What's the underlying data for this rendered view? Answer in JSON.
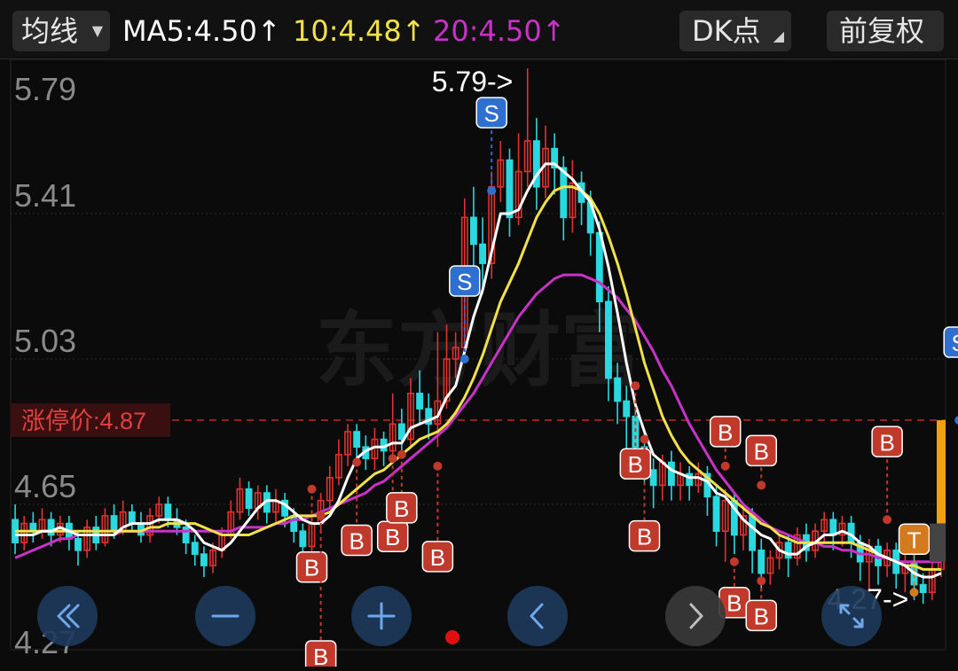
{
  "toolbar": {
    "ma_button_label": "均线",
    "ma5_text": "MA5:4.50↑",
    "ma10_text": "10:4.48↑",
    "ma20_text": "20:4.50↑",
    "dk_button_label": "DK点",
    "fuquan_button_label": "前复权"
  },
  "colors": {
    "up": "#e0322e",
    "down": "#2ad8e0",
    "ma5": "#ffffff",
    "ma10": "#f2e14a",
    "ma20": "#c832c8",
    "limit_line": "#c0282a",
    "signal_b": "#c0392b",
    "signal_s": "#2f6fd0",
    "signal_t": "#d47a1e",
    "nav_button": "#1e3a5c"
  },
  "watermark": "东方财富",
  "chart_data": {
    "type": "candlestick",
    "y_axis_ticks": [
      "5.79",
      "5.41",
      "5.03",
      "4.65",
      "4.27"
    ],
    "ylim": [
      4.27,
      5.79
    ],
    "limit_price_label": "涨停价:4.87",
    "limit_price_value": 4.87,
    "max_annotation": "5.79->",
    "min_annotation": "4.27->",
    "candles": [
      [
        4.61,
        4.55,
        4.65,
        4.52
      ],
      [
        4.55,
        4.6,
        4.62,
        4.53
      ],
      [
        4.6,
        4.58,
        4.63,
        4.55
      ],
      [
        4.58,
        4.61,
        4.64,
        4.56
      ],
      [
        4.61,
        4.57,
        4.63,
        4.54
      ],
      [
        4.57,
        4.6,
        4.62,
        4.55
      ],
      [
        4.6,
        4.56,
        4.62,
        4.53
      ],
      [
        4.56,
        4.53,
        4.58,
        4.49
      ],
      [
        4.53,
        4.59,
        4.61,
        4.51
      ],
      [
        4.59,
        4.55,
        4.62,
        4.53
      ],
      [
        4.55,
        4.62,
        4.64,
        4.54
      ],
      [
        4.62,
        4.58,
        4.65,
        4.56
      ],
      [
        4.58,
        4.63,
        4.66,
        4.57
      ],
      [
        4.63,
        4.6,
        4.65,
        4.58
      ],
      [
        4.6,
        4.57,
        4.63,
        4.55
      ],
      [
        4.57,
        4.62,
        4.64,
        4.55
      ],
      [
        4.62,
        4.65,
        4.67,
        4.6
      ],
      [
        4.65,
        4.61,
        4.67,
        4.59
      ],
      [
        4.61,
        4.59,
        4.64,
        4.57
      ],
      [
        4.59,
        4.55,
        4.61,
        4.52
      ],
      [
        4.55,
        4.52,
        4.57,
        4.49
      ],
      [
        4.52,
        4.49,
        4.54,
        4.46
      ],
      [
        4.49,
        4.53,
        4.55,
        4.47
      ],
      [
        4.53,
        4.57,
        4.59,
        4.51
      ],
      [
        4.57,
        4.63,
        4.66,
        4.56
      ],
      [
        4.63,
        4.69,
        4.72,
        4.61
      ],
      [
        4.69,
        4.64,
        4.71,
        4.62
      ],
      [
        4.64,
        4.68,
        4.7,
        4.61
      ],
      [
        4.68,
        4.63,
        4.7,
        4.6
      ],
      [
        4.63,
        4.66,
        4.69,
        4.6
      ],
      [
        4.66,
        4.62,
        4.68,
        4.59
      ],
      [
        4.62,
        4.58,
        4.64,
        4.55
      ],
      [
        4.58,
        4.54,
        4.6,
        4.5
      ],
      [
        4.54,
        4.6,
        4.62,
        4.52
      ],
      [
        4.6,
        4.66,
        4.68,
        4.58
      ],
      [
        4.66,
        4.72,
        4.75,
        4.64
      ],
      [
        4.72,
        4.78,
        4.82,
        4.7
      ],
      [
        4.78,
        4.84,
        4.86,
        4.75
      ],
      [
        4.84,
        4.8,
        4.86,
        4.77
      ],
      [
        4.8,
        4.77,
        4.83,
        4.74
      ],
      [
        4.77,
        4.82,
        4.85,
        4.74
      ],
      [
        4.82,
        4.79,
        4.84,
        4.75
      ],
      [
        4.79,
        4.86,
        4.94,
        4.76
      ],
      [
        4.86,
        4.82,
        4.9,
        4.78
      ],
      [
        4.82,
        4.94,
        4.98,
        4.8
      ],
      [
        4.94,
        4.9,
        5.0,
        4.86
      ],
      [
        4.9,
        4.86,
        4.94,
        4.82
      ],
      [
        4.86,
        4.92,
        5.1,
        4.8
      ],
      [
        4.92,
        5.03,
        5.12,
        4.9
      ],
      [
        5.03,
        5.06,
        5.1,
        4.98
      ],
      [
        5.06,
        5.4,
        5.45,
        5.04
      ],
      [
        5.4,
        5.33,
        5.48,
        5.25
      ],
      [
        5.33,
        5.28,
        5.4,
        5.2
      ],
      [
        5.28,
        5.48,
        5.52,
        5.24
      ],
      [
        5.48,
        5.55,
        5.6,
        5.44
      ],
      [
        5.55,
        5.4,
        5.58,
        5.35
      ],
      [
        5.4,
        5.52,
        5.62,
        5.38
      ],
      [
        5.52,
        5.6,
        5.79,
        5.48
      ],
      [
        5.6,
        5.48,
        5.66,
        5.42
      ],
      [
        5.48,
        5.58,
        5.64,
        5.45
      ],
      [
        5.58,
        5.53,
        5.62,
        5.46
      ],
      [
        5.53,
        5.4,
        5.56,
        5.34
      ],
      [
        5.4,
        5.49,
        5.55,
        5.36
      ],
      [
        5.49,
        5.44,
        5.52,
        5.38
      ],
      [
        5.44,
        5.36,
        5.47,
        5.3
      ],
      [
        5.36,
        5.18,
        5.39,
        5.1
      ],
      [
        5.18,
        4.98,
        5.22,
        4.92
      ],
      [
        4.98,
        4.92,
        5.02,
        4.86
      ],
      [
        4.92,
        4.88,
        4.96,
        4.76
      ],
      [
        4.88,
        4.8,
        4.92,
        4.72
      ],
      [
        4.8,
        4.74,
        4.84,
        4.7
      ],
      [
        4.74,
        4.7,
        4.77,
        4.64
      ],
      [
        4.7,
        4.76,
        4.78,
        4.66
      ],
      [
        4.76,
        4.7,
        4.79,
        4.66
      ],
      [
        4.7,
        4.73,
        4.76,
        4.66
      ],
      [
        4.73,
        4.7,
        4.75,
        4.66
      ],
      [
        4.7,
        4.73,
        4.76,
        4.68
      ],
      [
        4.73,
        4.67,
        4.75,
        4.62
      ],
      [
        4.67,
        4.58,
        4.7,
        4.54
      ],
      [
        4.58,
        4.66,
        4.69,
        4.5
      ],
      [
        4.66,
        4.57,
        4.68,
        4.52
      ],
      [
        4.57,
        4.62,
        4.65,
        4.53
      ],
      [
        4.62,
        4.53,
        4.64,
        4.47
      ],
      [
        4.53,
        4.47,
        4.56,
        4.43
      ],
      [
        4.47,
        4.51,
        4.53,
        4.44
      ],
      [
        4.51,
        4.55,
        4.57,
        4.48
      ],
      [
        4.55,
        4.51,
        4.57,
        4.46
      ],
      [
        4.51,
        4.57,
        4.59,
        4.49
      ],
      [
        4.57,
        4.53,
        4.6,
        4.5
      ],
      [
        4.53,
        4.58,
        4.6,
        4.51
      ],
      [
        4.58,
        4.61,
        4.63,
        4.55
      ],
      [
        4.61,
        4.57,
        4.63,
        4.53
      ],
      [
        4.57,
        4.6,
        4.62,
        4.54
      ],
      [
        4.6,
        4.55,
        4.62,
        4.51
      ],
      [
        4.55,
        4.5,
        4.57,
        4.45
      ],
      [
        4.5,
        4.54,
        4.56,
        4.42
      ],
      [
        4.54,
        4.49,
        4.56,
        4.44
      ],
      [
        4.49,
        4.53,
        4.55,
        4.46
      ],
      [
        4.53,
        4.47,
        4.55,
        4.43
      ],
      [
        4.47,
        4.5,
        4.52,
        4.42
      ],
      [
        4.5,
        4.44,
        4.52,
        4.4
      ],
      [
        4.44,
        4.42,
        4.47,
        4.39
      ],
      [
        4.42,
        4.48,
        4.5,
        4.4
      ],
      [
        4.48,
        4.52,
        4.55,
        4.46
      ]
    ],
    "ma5": [
      4.57,
      4.57,
      4.57,
      4.58,
      4.58,
      4.59,
      4.58,
      4.57,
      4.57,
      4.57,
      4.57,
      4.57,
      4.59,
      4.6,
      4.6,
      4.6,
      4.61,
      4.61,
      4.61,
      4.6,
      4.58,
      4.55,
      4.54,
      4.53,
      4.55,
      4.58,
      4.61,
      4.64,
      4.66,
      4.66,
      4.65,
      4.63,
      4.61,
      4.6,
      4.6,
      4.62,
      4.66,
      4.72,
      4.77,
      4.79,
      4.8,
      4.8,
      4.81,
      4.81,
      4.85,
      4.86,
      4.87,
      4.88,
      4.93,
      4.96,
      5.05,
      5.14,
      5.21,
      5.31,
      5.41,
      5.41,
      5.42,
      5.47,
      5.51,
      5.54,
      5.54,
      5.52,
      5.5,
      5.47,
      5.44,
      5.37,
      5.27,
      5.15,
      5.02,
      4.91,
      4.84,
      4.78,
      4.76,
      4.74,
      4.73,
      4.72,
      4.72,
      4.71,
      4.68,
      4.67,
      4.64,
      4.61,
      4.59,
      4.57,
      4.56,
      4.53,
      4.52,
      4.52,
      4.54,
      4.55,
      4.57,
      4.57,
      4.58,
      4.57,
      4.55,
      4.54,
      4.52,
      4.51,
      4.5,
      4.49,
      4.47,
      4.46,
      4.46,
      4.47
    ],
    "ma10": [
      4.58,
      4.58,
      4.58,
      4.58,
      4.58,
      4.58,
      4.58,
      4.58,
      4.58,
      4.58,
      4.58,
      4.58,
      4.58,
      4.58,
      4.58,
      4.59,
      4.59,
      4.6,
      4.6,
      4.6,
      4.6,
      4.59,
      4.58,
      4.57,
      4.57,
      4.57,
      4.57,
      4.58,
      4.59,
      4.6,
      4.61,
      4.62,
      4.62,
      4.62,
      4.62,
      4.63,
      4.65,
      4.67,
      4.69,
      4.71,
      4.73,
      4.74,
      4.76,
      4.78,
      4.8,
      4.82,
      4.83,
      4.84,
      4.86,
      4.89,
      4.93,
      4.98,
      5.04,
      5.11,
      5.18,
      5.23,
      5.28,
      5.34,
      5.4,
      5.44,
      5.47,
      5.48,
      5.48,
      5.47,
      5.45,
      5.41,
      5.35,
      5.28,
      5.2,
      5.11,
      5.02,
      4.95,
      4.88,
      4.83,
      4.79,
      4.76,
      4.74,
      4.72,
      4.7,
      4.68,
      4.66,
      4.64,
      4.62,
      4.6,
      4.59,
      4.57,
      4.56,
      4.55,
      4.55,
      4.55,
      4.55,
      4.55,
      4.55,
      4.55,
      4.54,
      4.53,
      4.52,
      4.51,
      4.5,
      4.49,
      4.49,
      4.48,
      4.48,
      4.48
    ],
    "ma20": [
      4.51,
      4.52,
      4.53,
      4.54,
      4.55,
      4.56,
      4.56,
      4.57,
      4.57,
      4.57,
      4.57,
      4.57,
      4.58,
      4.58,
      4.58,
      4.58,
      4.58,
      4.58,
      4.58,
      4.58,
      4.58,
      4.58,
      4.58,
      4.58,
      4.58,
      4.59,
      4.59,
      4.59,
      4.59,
      4.6,
      4.6,
      4.61,
      4.61,
      4.62,
      4.63,
      4.64,
      4.65,
      4.66,
      4.67,
      4.68,
      4.7,
      4.71,
      4.73,
      4.75,
      4.77,
      4.79,
      4.81,
      4.83,
      4.85,
      4.88,
      4.91,
      4.94,
      4.98,
      5.02,
      5.06,
      5.1,
      5.14,
      5.17,
      5.2,
      5.22,
      5.24,
      5.25,
      5.25,
      5.25,
      5.24,
      5.23,
      5.21,
      5.19,
      5.16,
      5.13,
      5.09,
      5.05,
      5.0,
      4.96,
      4.91,
      4.86,
      4.82,
      4.78,
      4.74,
      4.71,
      4.68,
      4.65,
      4.63,
      4.61,
      4.59,
      4.58,
      4.57,
      4.56,
      4.55,
      4.55,
      4.54,
      4.54,
      4.53,
      4.53,
      4.52,
      4.52,
      4.51,
      4.51,
      4.5,
      4.5,
      4.5,
      4.5,
      4.5,
      4.5
    ],
    "signals": [
      {
        "label": "B",
        "index": 33,
        "dir": "down",
        "dash": 1,
        "value": 4.69
      },
      {
        "label": "B",
        "index": 34,
        "dir": "down",
        "dash": 2,
        "value": 4.62
      },
      {
        "label": "B",
        "index": 38,
        "dir": "down",
        "dash": 1,
        "value": 4.76
      },
      {
        "label": "B",
        "index": 42,
        "dir": "down",
        "dash": 1,
        "value": 4.77
      },
      {
        "label": "B",
        "index": 43,
        "dir": "down",
        "dash": 0.6,
        "value": 4.78
      },
      {
        "label": "B",
        "index": 47,
        "dir": "down",
        "dash": 1.2,
        "value": 4.75
      },
      {
        "label": "S",
        "index": 50,
        "dir": "up",
        "dash": 1,
        "value": 5.03
      },
      {
        "label": "S",
        "index": 53,
        "dir": "up",
        "dash": 1,
        "value": 5.47
      },
      {
        "label": "B",
        "index": 69,
        "dir": "down",
        "dash": 1,
        "value": 4.96
      },
      {
        "label": "B",
        "index": 70,
        "dir": "down",
        "dash": 1.3,
        "value": 4.82
      },
      {
        "label": "B",
        "index": 79,
        "dir": "up",
        "dash": 0.3,
        "value": 4.75
      },
      {
        "label": "B",
        "index": 83,
        "dir": "up",
        "dash": 0.3,
        "value": 4.7
      },
      {
        "label": "B",
        "index": 80,
        "dir": "down",
        "dash": 0.4,
        "value": 4.5
      },
      {
        "label": "B",
        "index": 83,
        "dir": "down",
        "dash": 0.3,
        "value": 4.45
      },
      {
        "label": "B",
        "index": 97,
        "dir": "up",
        "dash": 1,
        "value": 4.61
      },
      {
        "label": "T",
        "index": 100,
        "dir": "up",
        "dash": 0.6,
        "value": 4.42
      },
      {
        "label": "S",
        "index": 105,
        "dir": "up",
        "dash": 1,
        "value": 4.87
      }
    ]
  },
  "nav": {
    "first_icon": "double-chevron-left-icon",
    "zoom_out_icon": "minus-icon",
    "zoom_in_icon": "plus-icon",
    "prev_icon": "chevron-left-icon",
    "next_icon": "chevron-right-icon",
    "fullscreen_icon": "expand-icon"
  }
}
